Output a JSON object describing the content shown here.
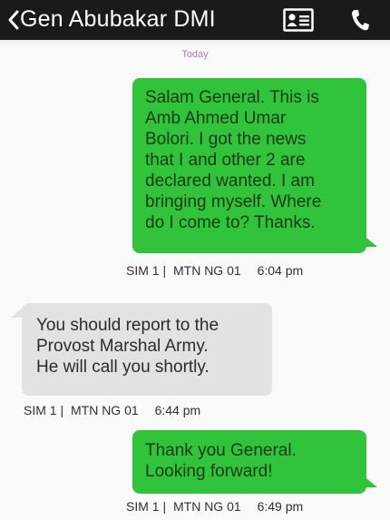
{
  "header": {
    "back_label": "<",
    "title": "Gen Abubakar DMI",
    "contact_icon": "contact-card-icon",
    "call_icon": "phone-icon"
  },
  "date_separator": "Today",
  "messages": [
    {
      "direction": "outgoing",
      "text": "Salam General. This is\nAmb Ahmed Umar\nBolori. I got the news\nthat I and other 2 are\ndeclared wanted. I am\nbringing myself. Where\ndo I come to? Thanks.",
      "sim": "SIM 1 |",
      "network": "MTN NG 01",
      "time": "6:04 pm"
    },
    {
      "direction": "incoming",
      "text": "You should report to the\nProvost Marshal Army.\nHe will call you shortly.",
      "sim": "SIM 1 |",
      "network": "MTN NG 01",
      "time": "6:44 pm"
    },
    {
      "direction": "outgoing",
      "text": "Thank you General.\nLooking forward!",
      "sim": "SIM 1 |",
      "network": "MTN NG 01",
      "time": "6:49 pm"
    }
  ],
  "colors": {
    "outgoing_bubble": "#31c33c",
    "incoming_bubble": "#e2e2e2",
    "header_bg": "#1a1a1a",
    "date_text": "#b07aa9"
  }
}
